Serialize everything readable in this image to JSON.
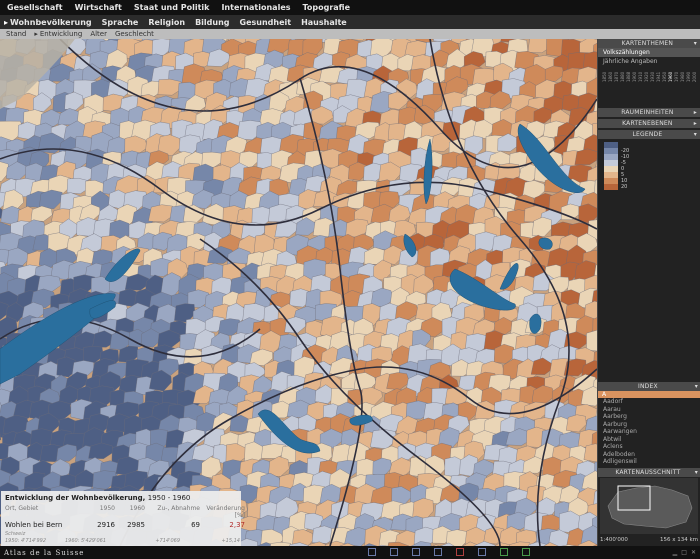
{
  "nav": {
    "top": [
      "Gesellschaft",
      "Wirtschaft",
      "Staat und Politik",
      "Internationales",
      "Topografie"
    ],
    "second": [
      "Wohnbevölkerung",
      "Sprache",
      "Religion",
      "Bildung",
      "Gesundheit",
      "Haushalte"
    ],
    "second_selected": 0,
    "third": [
      "Stand",
      "Entwicklung",
      "Alter",
      "Geschlecht"
    ],
    "third_selected": 1
  },
  "panel": {
    "kartenthemen": "KARTENTHEMEN",
    "themes": [
      "Volkszählungen",
      "Jährliche Angaben"
    ],
    "theme_selected": 0,
    "years": [
      "1850",
      "1860",
      "1870",
      "1880",
      "1888",
      "1900",
      "1910",
      "1920",
      "1930",
      "1941",
      "1950",
      "1960",
      "1970",
      "1980",
      "1990",
      "2000"
    ],
    "raumeinheiten": "RAUMEINHEITEN",
    "kartenebenen": "KARTENEBENEN",
    "legende": "LEGENDE",
    "legend_labels": [
      "-20",
      "-10",
      "-5",
      "0",
      "5",
      "10",
      "20"
    ],
    "legend_colors": [
      "#4e5f84",
      "#7687a9",
      "#9aa7c2",
      "#c4cad8",
      "#ead5b6",
      "#e3b58b",
      "#cf8a5a",
      "#b8653a"
    ],
    "index": "INDEX",
    "index_selected": "A",
    "index_items": [
      "Aadorf",
      "Aarau",
      "Aarberg",
      "Aarburg",
      "Aarwangen",
      "Abtwil",
      "Aclens",
      "Adelboden",
      "Adligenswil"
    ],
    "kartenausschnitt": "KARTENAUSSCHNITT",
    "scale": "1:400'000",
    "extent": "156 x 134 km"
  },
  "info": {
    "title": "Entwicklung der Wohnbevölkerung,",
    "period": "1950 - 1960",
    "cols": [
      "Ort, Gebiet",
      "1950",
      "1960",
      "Zu-, Abnahme",
      "Veränderung [%]"
    ],
    "row": {
      "place": "Wohlen bei Bern",
      "v1950": "2916",
      "v1960": "2985",
      "diff": "69",
      "pct": "2,37"
    },
    "sub": "Schweiz",
    "totals": [
      "1950: 4'714'992",
      "1960: 5'429'061",
      "+714'069",
      "+15,14"
    ]
  },
  "footer": {
    "logo": "Atlas de la Suisse"
  },
  "colors": {
    "lake": "#2a6f9e",
    "border": "#3a3a4a"
  }
}
